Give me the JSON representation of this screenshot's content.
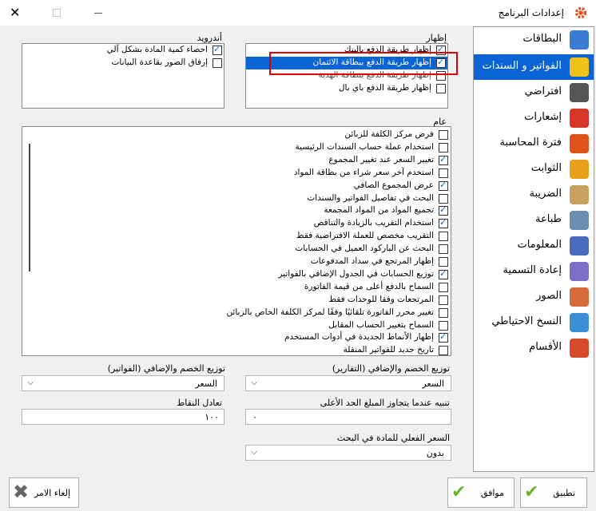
{
  "window": {
    "title": "إعدادات البرنامج"
  },
  "nav": {
    "items": [
      {
        "label": "البطاقات",
        "selected": false
      },
      {
        "label": "الفواتير و السندات",
        "selected": true
      },
      {
        "label": "افتراضي",
        "selected": false
      },
      {
        "label": "إشعارات",
        "selected": false
      },
      {
        "label": "فترة المحاسبة",
        "selected": false
      },
      {
        "label": "الثوابت",
        "selected": false
      },
      {
        "label": "الضريبة",
        "selected": false
      },
      {
        "label": "طباعة",
        "selected": false
      },
      {
        "label": "المعلومات",
        "selected": false
      },
      {
        "label": "إعادة التسمية",
        "selected": false
      },
      {
        "label": "الصور",
        "selected": false
      },
      {
        "label": "النسخ الاحتياطي",
        "selected": false
      },
      {
        "label": "الأقسام",
        "selected": false
      }
    ]
  },
  "show_group": {
    "title": "إظهار",
    "items": [
      {
        "label": "إظهار طريقة الدفع بالبنك",
        "checked": true
      },
      {
        "label": "إظهار طريقة الدفع ببطاقة الائتمان",
        "checked": true
      },
      {
        "label": "إظهار طريقة الدفع ببطاقة الهدية",
        "checked": false
      },
      {
        "label": "إظهار طريقة الدفع باي بال",
        "checked": false
      }
    ]
  },
  "android_group": {
    "title": "أندرويد",
    "items": [
      {
        "label": "احصاء كمية المادة بشكل آلي",
        "checked": true
      },
      {
        "label": "إرفاق الصور بقاعدة البيانات",
        "checked": false
      }
    ]
  },
  "general_group": {
    "title": "عام",
    "items": [
      {
        "label": "فرض مركز الكلفة للزبائن",
        "checked": false
      },
      {
        "label": "استخدام عملة حساب السندات الرئيسية",
        "checked": false
      },
      {
        "label": "تغيير السعر عند تغيير المجموع",
        "checked": true
      },
      {
        "label": "استخدم آخر سعر شراء من بطاقة المواد",
        "checked": false
      },
      {
        "label": "عرض المجموع الصافي",
        "checked": true
      },
      {
        "label": "البحث في تفاصيل الفواتير والسندات",
        "checked": false
      },
      {
        "label": "تجميع المواد من المواد المجمعة",
        "checked": true
      },
      {
        "label": "استخدام التقريب بالزيادة والتناقص",
        "checked": true
      },
      {
        "label": "التقريب مخصص للعملة الافتراضية فقط",
        "checked": false
      },
      {
        "label": "البحث عن الباركود العميل في الحسابات",
        "checked": false
      },
      {
        "label": "إظهار المرتجع في سداد المدفوعات",
        "checked": false
      },
      {
        "label": "توزيع الحسابات في الجدول الإضافي بالفواتير",
        "checked": true
      },
      {
        "label": "السماح بالدفع أعلى من قيمة الفاتورة",
        "checked": false
      },
      {
        "label": "المرتجعات وفقا للوحدات فقط",
        "checked": false
      },
      {
        "label": "تغيير محرر الفاتورة تلقائيًا وفقًا لمركز الكلفة الخاص بالزبائن",
        "checked": false
      },
      {
        "label": "السماح بتغيير الحساب المقابل",
        "checked": false
      },
      {
        "label": "إظهار الأنماط الجديدة في أدوات المستخدم",
        "checked": true
      },
      {
        "label": "تاريخ جديد للفواتير المنقلة",
        "checked": false
      }
    ]
  },
  "fields": {
    "discount_reports": {
      "label": "توزيع الخصم والإضافي (التقارير)",
      "value": "السعر"
    },
    "discount_invoices": {
      "label": "توزيع الخصم والإضافي (الفواتير)",
      "value": "السعر"
    },
    "warn_exceed": {
      "label": "تنبيه عندما يتجاوز المبلغ الحد الأعلى",
      "value": "٠"
    },
    "points_equiv": {
      "label": "تعادل النقاط",
      "value": "١٠٠"
    },
    "actual_price": {
      "label": "السعر الفعلي للمادة في البحث",
      "value": "بدون"
    }
  },
  "buttons": {
    "apply": "تطبيق",
    "ok": "موافق",
    "cancel": "إلغاء الامر"
  }
}
